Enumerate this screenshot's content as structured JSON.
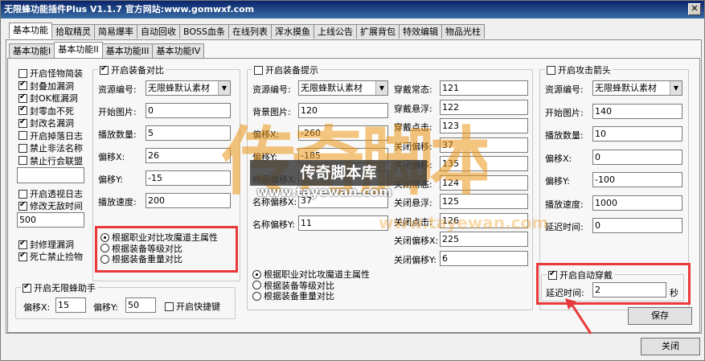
{
  "window": {
    "title": "无限蜂功能插件Plus V1.1.7   官方网站:www.gomwxf.com",
    "close_glyph": "✕"
  },
  "main_tabs": [
    "基本功能",
    "拾取精灵",
    "简易爆率",
    "自动回收",
    "BOSS血条",
    "在线列表",
    "浑水摸鱼",
    "上线公告",
    "扩展背包",
    "特效编辑",
    "物品光柱"
  ],
  "sub_tabs": [
    "基本功能I",
    "基本功能II",
    "基本功能III",
    "基本功能IV"
  ],
  "left": {
    "checks": [
      {
        "label": "开启怪物简装",
        "checked": false
      },
      {
        "label": "封叠加漏洞",
        "checked": true
      },
      {
        "label": "封OK框漏洞",
        "checked": true
      },
      {
        "label": "封零血不死",
        "checked": true
      },
      {
        "label": "封改名漏洞",
        "checked": true
      },
      {
        "label": "开启掉落日志",
        "checked": false
      },
      {
        "label": "禁止非法名称",
        "checked": false
      },
      {
        "label": "禁止行会联盟",
        "checked": false
      }
    ],
    "text_box": "",
    "checks2": [
      {
        "label": "开启透视日志",
        "checked": false
      },
      {
        "label": "修改无敌时间",
        "checked": true
      }
    ],
    "invincible_time": "500",
    "checks3": [
      {
        "label": "封修理漏洞",
        "checked": true
      },
      {
        "label": "死亡禁止捡物",
        "checked": true
      }
    ],
    "helper": {
      "title": "开启无限蜂助手",
      "checked": true,
      "offset_x_label": "偏移X:",
      "offset_x": "15",
      "offset_y_label": "偏移Y:",
      "offset_y": "50",
      "fast_key": "开启快捷键",
      "fast_checked": false
    }
  },
  "compare": {
    "title": "开启装备对比",
    "checked": true,
    "rows": [
      {
        "label": "资源编号:",
        "value": "无限蜂默认素材",
        "select": true
      },
      {
        "label": "开始图片:",
        "value": "0"
      },
      {
        "label": "播放数量:",
        "value": "5"
      },
      {
        "label": "偏移X:",
        "value": "26"
      },
      {
        "label": "偏移Y:",
        "value": "-15"
      },
      {
        "label": "播放速度:",
        "value": "200"
      }
    ],
    "radios": [
      {
        "label": "根据职业对比攻魔道主属性",
        "on": true
      },
      {
        "label": "根据装备等级对比",
        "on": false
      },
      {
        "label": "根据装备重量对比",
        "on": false
      }
    ]
  },
  "tips": {
    "title": "开启装备提示",
    "checked": false,
    "left_rows": [
      {
        "label": "资源编号:",
        "value": "无限蜂默认素材",
        "select": true
      },
      {
        "label": "背景图片:",
        "value": "120"
      },
      {
        "label": "偏移X:",
        "value": "-260"
      },
      {
        "label": "偏移Y:",
        "value": "-185"
      },
      {
        "label": "物品偏移X:",
        "value": "5"
      },
      {
        "label": "名称偏移X:",
        "value": "37"
      },
      {
        "label": "名称偏移Y:",
        "value": "11"
      }
    ],
    "right_rows": [
      {
        "label": "穿戴常态:",
        "value": "121"
      },
      {
        "label": "穿戴悬浮:",
        "value": "122"
      },
      {
        "label": "穿戴点击:",
        "value": "123"
      },
      {
        "label": "关闭偏移:",
        "value": "37"
      },
      {
        "label": "关闭偏移:",
        "value": "135"
      },
      {
        "label": "关闭常态:",
        "value": "124"
      },
      {
        "label": "关闭悬浮:",
        "value": "125"
      },
      {
        "label": "关闭点击:",
        "value": "126"
      },
      {
        "label": "关闭偏移X:",
        "value": "225"
      },
      {
        "label": "关闭偏移Y:",
        "value": "6"
      }
    ],
    "radios": [
      {
        "label": "根据职业对比攻魔道主属性",
        "on": true
      },
      {
        "label": "根据装备等级对比",
        "on": false
      },
      {
        "label": "根据装备重量对比",
        "on": false
      }
    ]
  },
  "arrow": {
    "title": "开启攻击箭头",
    "checked": false,
    "rows": [
      {
        "label": "资源编号:",
        "value": "无限蜂默认素材",
        "select": true
      },
      {
        "label": "开始图片:",
        "value": "140"
      },
      {
        "label": "播放数量:",
        "value": "10"
      },
      {
        "label": "偏移X:",
        "value": "0"
      },
      {
        "label": "偏移Y:",
        "value": "-100"
      },
      {
        "label": "播放速度:",
        "value": "1000"
      },
      {
        "label": "延迟时间:",
        "value": "0"
      }
    ],
    "auto_wear": {
      "title": "开启自动穿戴",
      "checked": true,
      "delay_label": "延迟时间:",
      "delay": "2",
      "unit": "秒"
    }
  },
  "buttons": {
    "save": "保存",
    "close": "关闭"
  },
  "watermark": {
    "big": "传奇脚本",
    "banner": "传奇脚本库",
    "url1": "www.tayewan.com",
    "url2": "www.tayewan.com"
  },
  "colors": {
    "highlight": "#e83a3a",
    "watermark": "#eb9614"
  }
}
